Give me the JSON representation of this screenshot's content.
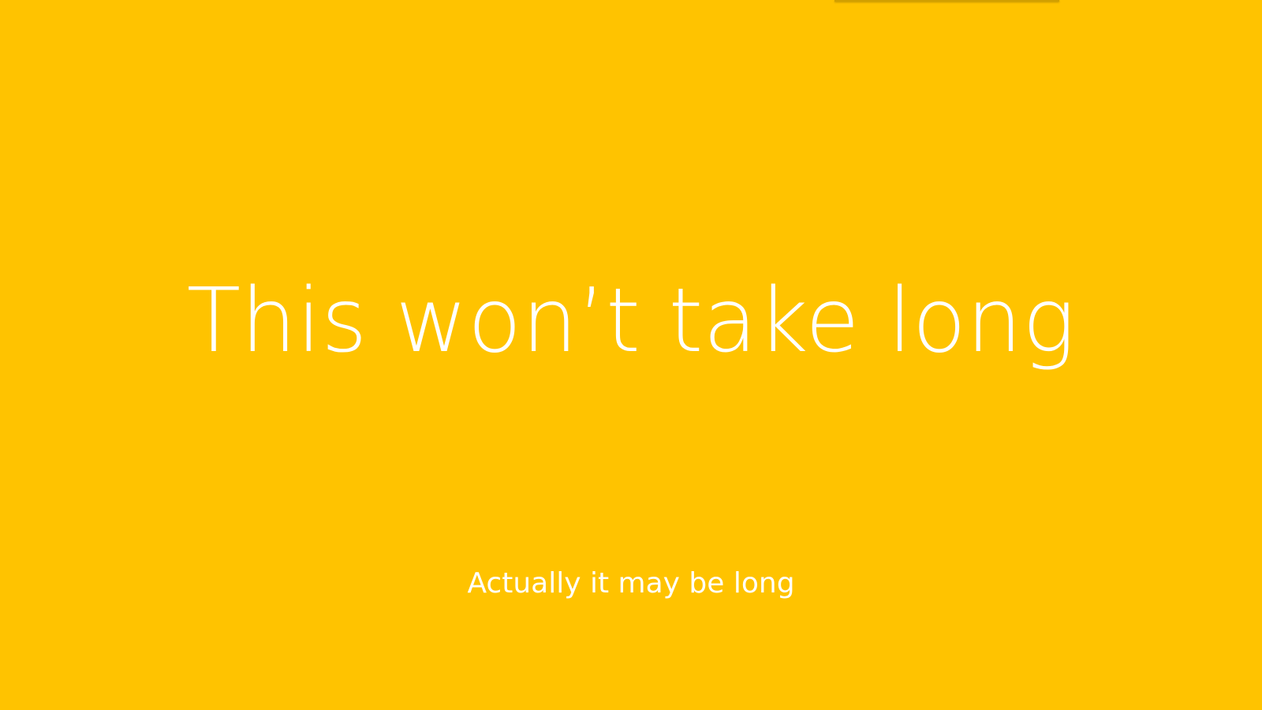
{
  "screen": {
    "background_color": "#FFC300",
    "text_color": "#FFFFFF",
    "headline": "This won’t take long",
    "subtext": "Actually it may be long"
  }
}
